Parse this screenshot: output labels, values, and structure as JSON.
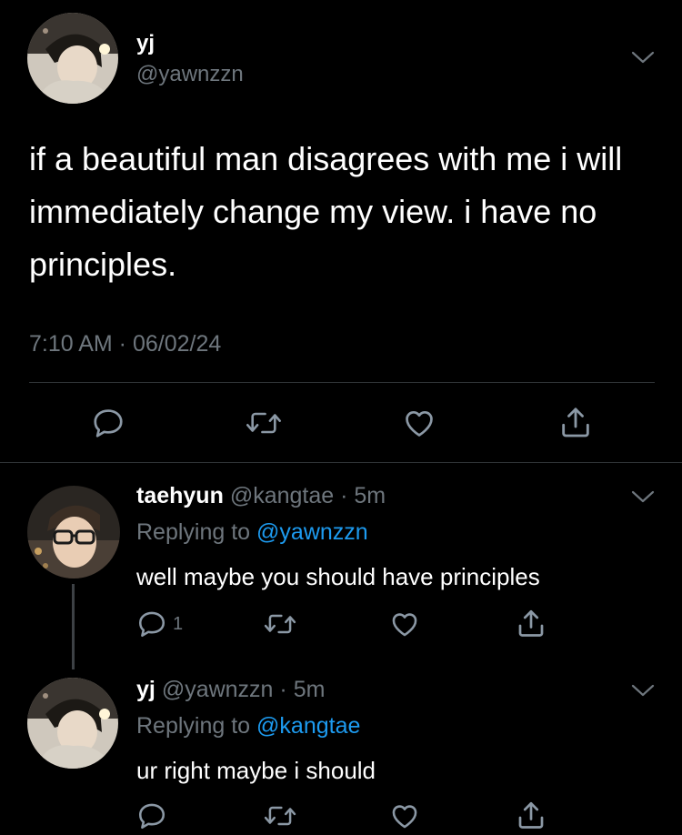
{
  "main_tweet": {
    "display_name": "yj",
    "handle": "@yawnzzn",
    "text": "if a beautiful man disagrees with me i will immediately change my view. i have no principles.",
    "timestamp": "7:10 AM · 06/02/24"
  },
  "replies": [
    {
      "display_name": "taehyun",
      "handle": "@kangtae",
      "time": "· 5m",
      "replying_prefix": "Replying to",
      "replying_to": "@yawnzzn",
      "text": "well maybe you should have principles",
      "reply_count": "1"
    },
    {
      "display_name": "yj",
      "handle": "@yawnzzn",
      "time": "· 5m",
      "replying_prefix": "Replying to",
      "replying_to": "@kangtae",
      "text": "ur right maybe i should"
    }
  ],
  "icons": {
    "reply": "reply-icon",
    "retweet": "retweet-icon",
    "like": "heart-icon",
    "share": "share-icon",
    "more": "chevron-down-icon"
  },
  "colors": {
    "background": "#000000",
    "text": "#ffffff",
    "muted": "#6e767d",
    "link": "#1d9bf0",
    "divider": "#2f3336"
  }
}
